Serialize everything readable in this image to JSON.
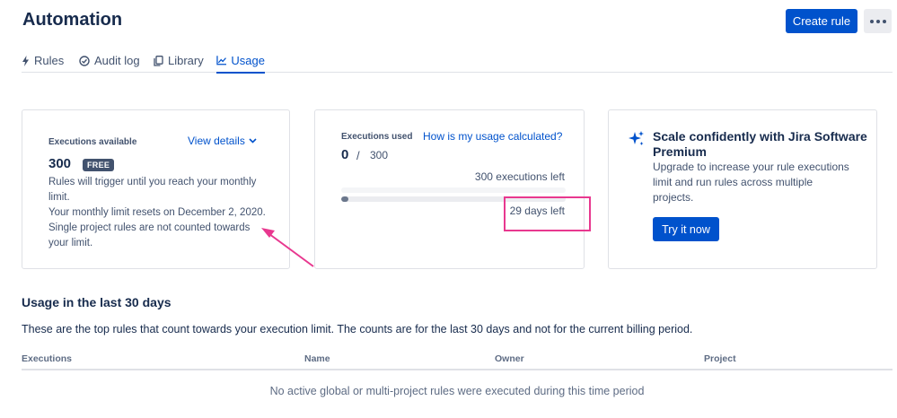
{
  "header": {
    "title": "Automation",
    "create_rule_label": "Create rule"
  },
  "tabs": [
    {
      "label": "Rules",
      "icon": "bolt-icon",
      "active": false
    },
    {
      "label": "Audit log",
      "icon": "check-circle-icon",
      "active": false
    },
    {
      "label": "Library",
      "icon": "copy-icon",
      "active": false
    },
    {
      "label": "Usage",
      "icon": "chart-icon",
      "active": true
    }
  ],
  "card_available": {
    "label": "Executions available",
    "view_details": "View details",
    "count": "300",
    "badge": "FREE",
    "line1": "Rules will trigger until you reach your monthly",
    "line2": "limit.",
    "line3": "Your monthly limit resets on December 2, 2020.",
    "line4": "Single project rules are not counted towards",
    "line5": "your limit."
  },
  "card_used": {
    "label": "Executions used",
    "link": "How is my usage calculated?",
    "used": "0",
    "separator": "/",
    "total": "300",
    "executions_left": "300 executions left",
    "days_left": "29 days left",
    "usage_fraction": 0
  },
  "card_premium": {
    "title": "Scale confidently with Jira Software Premium",
    "line1": "Upgrade to increase your rule executions",
    "line2": "limit and run rules across multiple",
    "line3": "projects.",
    "button": "Try it now"
  },
  "usage": {
    "title": "Usage in the last 30 days",
    "description": "These are the top rules that count towards your execution limit. The counts are for the last 30 days and not for the current billing period.",
    "columns": [
      "Executions",
      "Name",
      "Owner",
      "Project"
    ],
    "empty": "No active global or multi-project rules were executed during this time period"
  },
  "colors": {
    "primary": "#0052cc",
    "annotation": "#e8388f",
    "text": "#172b4d",
    "subtle": "#42526e"
  }
}
